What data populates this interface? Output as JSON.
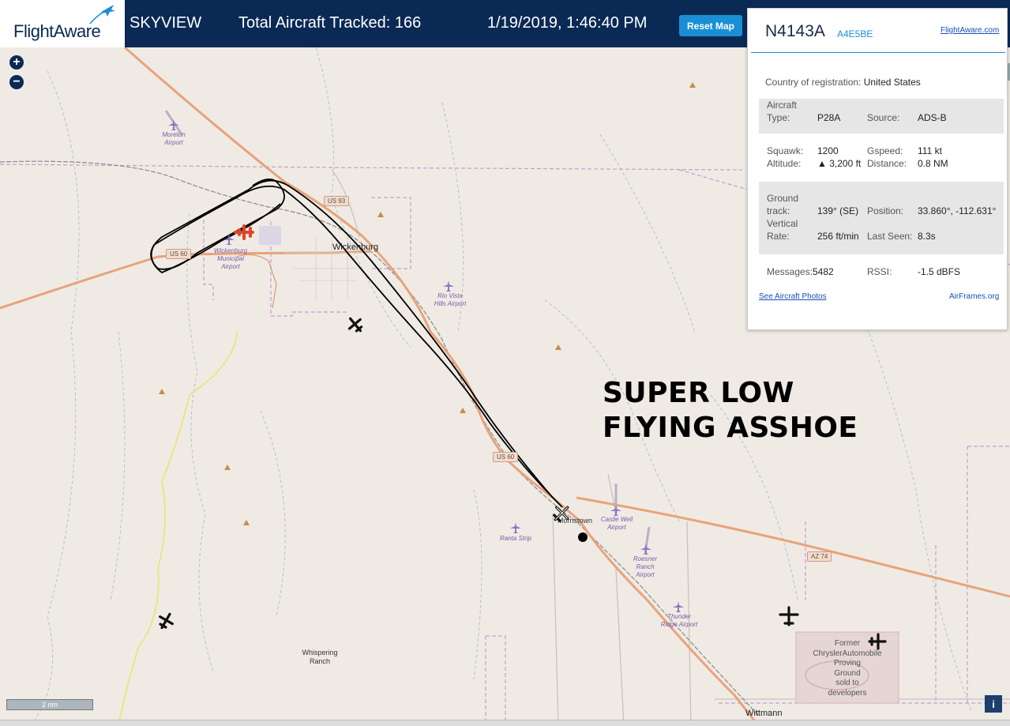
{
  "header": {
    "logo": "FlightAware",
    "section": "SKYVIEW",
    "tracked": "Total Aircraft Tracked: 166",
    "datetime": "1/19/2019, 1:46:40 PM",
    "reset_label": "Reset Map"
  },
  "map": {
    "zoom_in": "+",
    "zoom_out": "−",
    "towns": {
      "wickenburg": "Wickenburg",
      "morristown": "Morristown",
      "wittmann": "Wittmann"
    },
    "places": {
      "whispering": "Whispering\nRanch",
      "proving": "Former\nChryslerAutomobile\nProving\nGround\nsold to\ndevelopers"
    },
    "airports": {
      "moreton": "Moreton\nAirport",
      "wickenburg": "Wickenburg\nMunicipal\nAirport",
      "riovista": "Rio Vista\nHills Airport",
      "castlewell": "Castle Well\nAirport",
      "ranta": "Ranta Strip",
      "roesner": "Roesner\nRanch\nAirport",
      "thunder": "Thunder\nRidge Airport"
    },
    "shields": {
      "us93": "US 93",
      "us60a": "US 60",
      "us60b": "US 60",
      "az74": "AZ 74"
    },
    "scale": "2 nm",
    "info": "i"
  },
  "annotation": {
    "line1": "SUPER LOW",
    "line2": "FLYING ASSHOE"
  },
  "panel": {
    "registration": "N4143A",
    "hex": "A4E5BE",
    "fa_link": "FlightAware.com",
    "country_label": "Country of registration:",
    "country_value": "United States",
    "aircraft_type_label1": "Aircraft",
    "aircraft_type_label2": "Type:",
    "aircraft_type": "P28A",
    "source_label": "Source:",
    "source": "ADS-B",
    "squawk_label": "Squawk:",
    "squawk": "1200",
    "gspeed_label": "Gspeed:",
    "gspeed": "111 kt",
    "altitude_label": "Altitude:",
    "altitude": "▲ 3,200 ft",
    "distance_label": "Distance:",
    "distance": "0.8 NM",
    "track_label1": "Ground",
    "track_label2": "track:",
    "track": "139° (SE)",
    "position_label": "Position:",
    "position": "33.860°, -112.631°",
    "vrate_label1": "Vertical",
    "vrate_label2": "Rate:",
    "vrate": "256 ft/min",
    "lastseen_label": "Last Seen:",
    "lastseen": "8.3s",
    "messages_label": "Messages:",
    "messages": "5482",
    "rssi_label": "RSSI:",
    "rssi": "-1.5 dBFS",
    "photos_link": "See Aircraft Photos",
    "airframes_link": "AirFrames.org"
  },
  "colors": {
    "header_bg": "#0a2a55",
    "accent": "#1a8fd6",
    "map_bg": "#efebe4",
    "highway": "#e8a37a",
    "track_line": "#000000",
    "selected_plane": "#e0442a"
  }
}
